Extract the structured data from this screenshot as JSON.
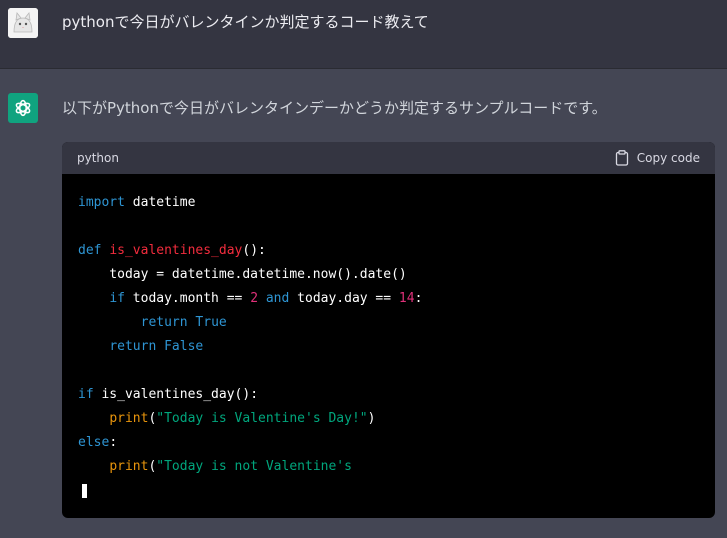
{
  "user_message": {
    "text": "pythonで今日がバレンタインか判定するコード教えて"
  },
  "assistant_message": {
    "intro_text": "以下がPythonで今日がバレンタインデーかどうか判定するサンプルコードです。",
    "code_block": {
      "language": "python",
      "copy_label": "Copy code",
      "code_tokens": {
        "import_kw": "import",
        "datetime_mod": " datetime",
        "def_kw": "def",
        "fn_name": "is_valentines_day",
        "fn_sig_rest": "():",
        "today_assign": "    today = datetime.datetime.now().date()",
        "if_kw_indent": "    ",
        "if_kw": "if",
        "cond_part1": " today.month == ",
        "num_2": "2",
        "and_kw": "and",
        "cond_part2": " today.day == ",
        "num_14": "14",
        "colon": ":",
        "return_indent_2": "        ",
        "return_true": "return True",
        "return_indent_1": "    ",
        "return_false": "return False",
        "if2_kw": "if",
        "if2_rest": " is_valentines_day():",
        "print_indent": "    ",
        "print_fn": "print",
        "print1_open": "(",
        "print1_str": "\"Today is Valentine's Day!\"",
        "print1_close": ")",
        "else_kw": "else",
        "else_colon": ":",
        "print2_str": "\"Today is not Valentine's"
      }
    }
  }
}
